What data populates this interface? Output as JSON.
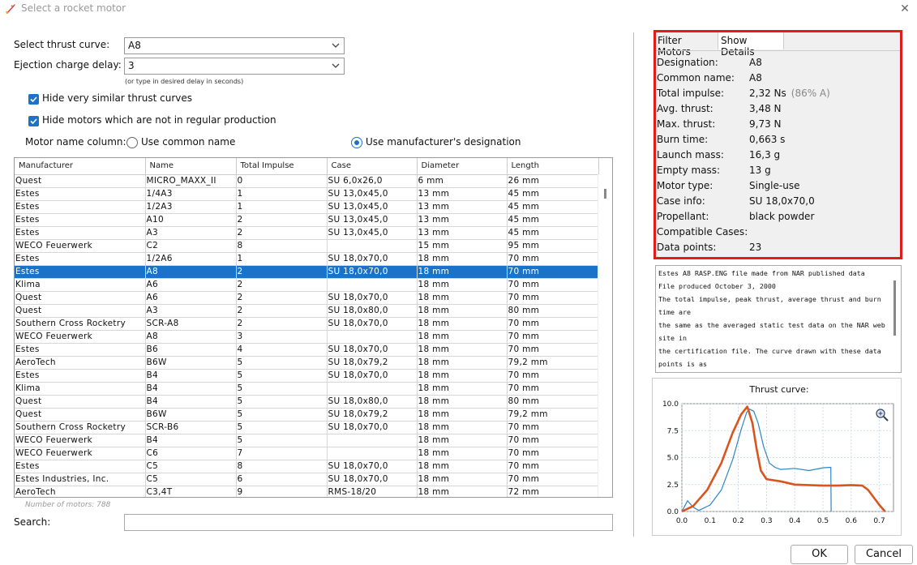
{
  "window": {
    "title": "Select a rocket motor"
  },
  "form": {
    "thrust_curve_label": "Select thrust curve:",
    "thrust_curve_value": "A8",
    "ejection_label": "Ejection charge delay:",
    "ejection_value": "3",
    "ejection_hint": "(or type in desired delay in seconds)",
    "hide_similar_label": "Hide very similar thrust curves",
    "hide_similar_checked": true,
    "hide_not_regular_label": "Hide motors which are not in regular production",
    "hide_not_regular_checked": true,
    "motor_name_column_label": "Motor name column:",
    "use_common_name_label": "Use common name",
    "use_manufacturer_label": "Use manufacturer's designation",
    "selected_name_option": "manufacturer"
  },
  "table": {
    "columns": [
      "Manufacturer",
      "Name",
      "Total Impulse",
      "Case",
      "Diameter",
      "Length"
    ],
    "selected_index": 7,
    "rows": [
      [
        "Quest",
        "MICRO_MAXX_II",
        "0",
        "SU 6,0x26,0",
        "6 mm",
        "26 mm"
      ],
      [
        "Estes",
        "1/4A3",
        "1",
        "SU 13,0x45,0",
        "13 mm",
        "45 mm"
      ],
      [
        "Estes",
        "1/2A3",
        "1",
        "SU 13,0x45,0",
        "13 mm",
        "45 mm"
      ],
      [
        "Estes",
        "A10",
        "2",
        "SU 13,0x45,0",
        "13 mm",
        "45 mm"
      ],
      [
        "Estes",
        "A3",
        "2",
        "SU 13,0x45,0",
        "13 mm",
        "45 mm"
      ],
      [
        "WECO Feuerwerk",
        "C2",
        "8",
        "",
        "15 mm",
        "95 mm"
      ],
      [
        "Estes",
        "1/2A6",
        "1",
        "SU 18,0x70,0",
        "18 mm",
        "70 mm"
      ],
      [
        "Estes",
        "A8",
        "2",
        "SU 18,0x70,0",
        "18 mm",
        "70 mm"
      ],
      [
        "Klima",
        "A6",
        "2",
        "",
        "18 mm",
        "70 mm"
      ],
      [
        "Quest",
        "A6",
        "2",
        "SU 18,0x70,0",
        "18 mm",
        "70 mm"
      ],
      [
        "Quest",
        "A3",
        "2",
        "SU 18,0x80,0",
        "18 mm",
        "80 mm"
      ],
      [
        "Southern Cross Rocketry",
        "SCR-A8",
        "2",
        "SU 18,0x70,0",
        "18 mm",
        "70 mm"
      ],
      [
        "WECO Feuerwerk",
        "A8",
        "3",
        "",
        "18 mm",
        "70 mm"
      ],
      [
        "Estes",
        "B6",
        "4",
        "SU 18,0x70,0",
        "18 mm",
        "70 mm"
      ],
      [
        "AeroTech",
        "B6W",
        "5",
        "SU 18,0x79,2",
        "18 mm",
        "79,2 mm"
      ],
      [
        "Estes",
        "B4",
        "5",
        "SU 18,0x70,0",
        "18 mm",
        "70 mm"
      ],
      [
        "Klima",
        "B4",
        "5",
        "",
        "18 mm",
        "70 mm"
      ],
      [
        "Quest",
        "B4",
        "5",
        "SU 18,0x80,0",
        "18 mm",
        "80 mm"
      ],
      [
        "Quest",
        "B6W",
        "5",
        "SU 18,0x79,2",
        "18 mm",
        "79,2 mm"
      ],
      [
        "Southern Cross Rocketry",
        "SCR-B6",
        "5",
        "SU 18,0x70,0",
        "18 mm",
        "70 mm"
      ],
      [
        "WECO Feuerwerk",
        "B4",
        "5",
        "",
        "18 mm",
        "70 mm"
      ],
      [
        "WECO Feuerwerk",
        "C6",
        "7",
        "",
        "18 mm",
        "70 mm"
      ],
      [
        "Estes",
        "C5",
        "8",
        "SU 18,0x70,0",
        "18 mm",
        "70 mm"
      ],
      [
        "Estes Industries, Inc.",
        "C5",
        "6",
        "SU 18,0x70,0",
        "18 mm",
        "70 mm"
      ],
      [
        "AeroTech",
        "C3,4T",
        "9",
        "RMS-18/20",
        "18 mm",
        "72 mm"
      ]
    ],
    "count_text": "Number of motors: 788"
  },
  "search": {
    "label": "Search:",
    "value": ""
  },
  "tabs": {
    "filter": "Filter Motors",
    "details": "Show Details",
    "active": "details"
  },
  "details": [
    {
      "label": "Designation:",
      "value": "A8",
      "extra": ""
    },
    {
      "label": "Common name:",
      "value": "A8",
      "extra": ""
    },
    {
      "label": "Total impulse:",
      "value": "2,32 Ns",
      "extra": "(86% A)"
    },
    {
      "label": "Avg. thrust:",
      "value": "3,48 N",
      "extra": ""
    },
    {
      "label": "Max. thrust:",
      "value": "9,73 N",
      "extra": ""
    },
    {
      "label": "Burn time:",
      "value": "0,663 s",
      "extra": ""
    },
    {
      "label": "Launch mass:",
      "value": "16,3 g",
      "extra": ""
    },
    {
      "label": "Empty mass:",
      "value": "13 g",
      "extra": ""
    },
    {
      "label": "Motor type:",
      "value": "Single-use",
      "extra": ""
    },
    {
      "label": "Case info:",
      "value": "SU 18,0x70,0",
      "extra": ""
    },
    {
      "label": "Propellant:",
      "value": "black powder",
      "extra": ""
    },
    {
      "label": "Compatible Cases:",
      "value": "",
      "extra": ""
    },
    {
      "label": "Data points:",
      "value": "23",
      "extra": ""
    }
  ],
  "description_lines": [
    "Estes A8 RASP.ENG file made from NAR published data",
    "File produced October 3, 2000",
    "The total impulse, peak thrust, average thrust and burn",
    "time are",
    "the same as the averaged static test data on the NAR web",
    "site in",
    "the certification file. The curve drawn with these data",
    "points is as"
  ],
  "chart_data": {
    "type": "line",
    "title": "Thrust curve:",
    "xlim": [
      0.0,
      0.75
    ],
    "ylim": [
      0.0,
      10.0
    ],
    "x_ticks": [
      "0.0",
      "0.1",
      "0.2",
      "0.3",
      "0.4",
      "0.5",
      "0.6",
      "0.7"
    ],
    "y_ticks": [
      "0.0",
      "2.5",
      "5.0",
      "7.5",
      "10.0"
    ],
    "grid": true,
    "series": [
      {
        "color": "#d9541e",
        "x": [
          0.0,
          0.04,
          0.09,
          0.14,
          0.18,
          0.21,
          0.232,
          0.25,
          0.265,
          0.28,
          0.3,
          0.35,
          0.4,
          0.5,
          0.55,
          0.6,
          0.64,
          0.66,
          0.7,
          0.72
        ],
        "y": [
          0.0,
          0.5,
          2.0,
          4.5,
          7.3,
          9.0,
          9.73,
          8.2,
          5.8,
          3.8,
          3.0,
          2.8,
          2.5,
          2.4,
          2.4,
          2.45,
          2.4,
          2.0,
          0.6,
          0.0
        ]
      },
      {
        "color": "#2f86c0",
        "x": [
          0.0,
          0.02,
          0.04,
          0.06,
          0.1,
          0.14,
          0.18,
          0.21,
          0.23,
          0.24,
          0.255,
          0.27,
          0.29,
          0.31,
          0.33,
          0.35,
          0.4,
          0.45,
          0.5,
          0.528,
          0.529
        ],
        "y": [
          0.0,
          1.0,
          0.4,
          0.1,
          0.6,
          2.0,
          4.8,
          7.6,
          9.2,
          9.5,
          9.3,
          8.2,
          6.0,
          4.5,
          4.1,
          3.9,
          4.0,
          3.8,
          4.05,
          4.1,
          0.0
        ]
      }
    ]
  },
  "buttons": {
    "ok": "OK",
    "cancel": "Cancel"
  }
}
